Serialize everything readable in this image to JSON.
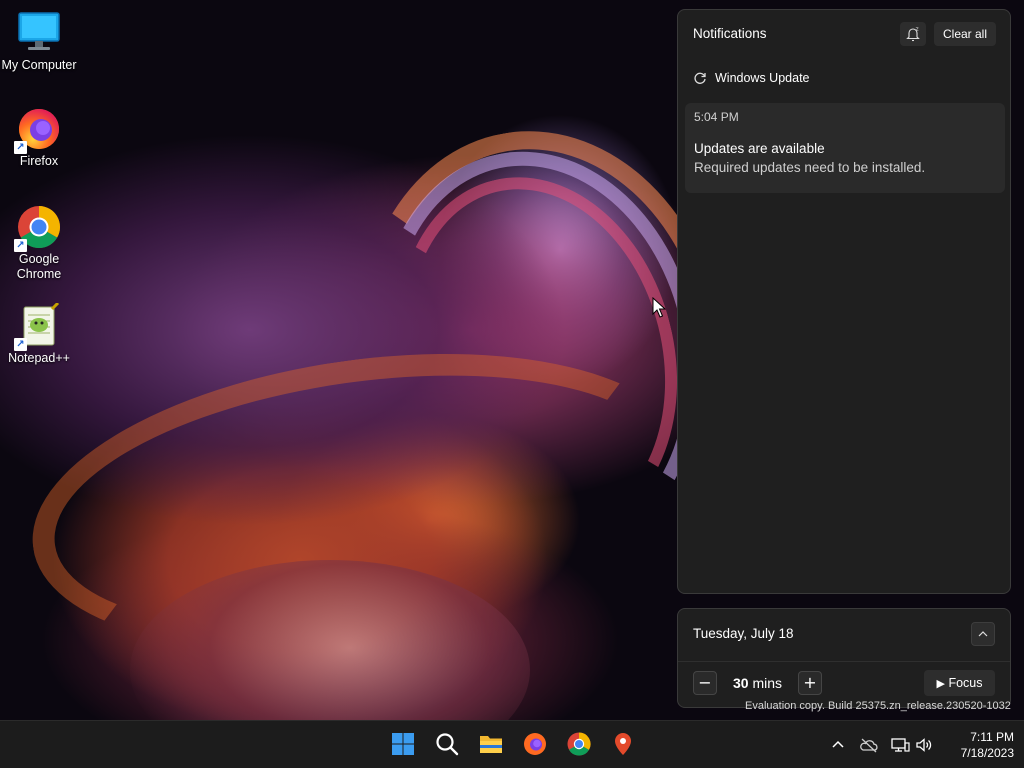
{
  "desktop": {
    "icons": [
      {
        "label": "My Computer"
      },
      {
        "label": "Firefox"
      },
      {
        "label": "Google Chrome"
      },
      {
        "label": "Notepad++"
      }
    ]
  },
  "notifications": {
    "title": "Notifications",
    "clear_all_label": "Clear all",
    "app_name": "Windows Update",
    "card": {
      "time": "5:04 PM",
      "heading": "Updates are available",
      "body": "Required updates need to be installed."
    }
  },
  "calendar": {
    "date": "Tuesday, July 18",
    "focus_value": "30",
    "focus_unit": "mins",
    "focus_label": "Focus",
    "minus_label": "−",
    "plus_label": "+"
  },
  "watermark": "Evaluation copy. Build 25375.zn_release.230520-1032",
  "taskbar": {
    "apps": [
      "start-icon",
      "search-icon",
      "file-explorer-icon",
      "firefox-icon",
      "chrome-icon",
      "maps-icon"
    ],
    "tray": [
      "chevron-up-icon",
      "onedrive-icon",
      "network-icon",
      "volume-icon"
    ],
    "time": "7:11 PM",
    "date": "7/18/2023"
  },
  "colors": {
    "panel_bg": "#1f1f1f",
    "card_bg": "#2a2a2a",
    "taskbar_bg": "#1c1c1c",
    "accent_blue": "#3b9cf0"
  }
}
